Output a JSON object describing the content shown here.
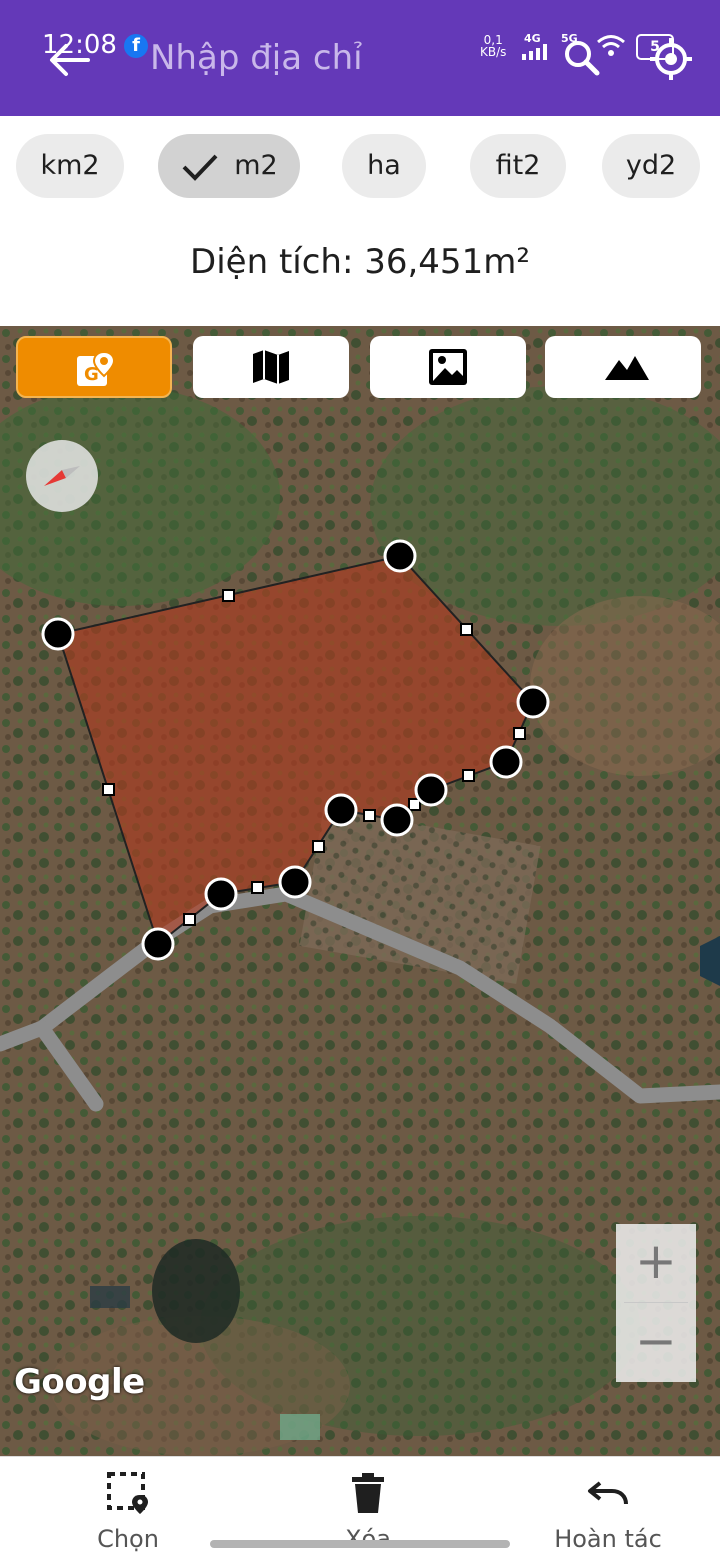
{
  "status_bar": {
    "time": "12:08",
    "facebook_badge": "f",
    "net_speed_value": "0,1",
    "net_speed_unit": "KB/s",
    "network_1": "4G",
    "network_2": "5G",
    "battery": "5"
  },
  "header": {
    "search_placeholder": "Nhập địa chỉ",
    "bg_color": "#6439b8"
  },
  "units": {
    "options": [
      "km2",
      "m2",
      "ha",
      "fit2",
      "yd2"
    ],
    "selected": "m2"
  },
  "area_label": "Diện tích: 36,451m²",
  "map": {
    "types": [
      "google-maps-icon",
      "map-icon",
      "satellite-icon",
      "terrain-icon"
    ],
    "active_type": "google-maps-icon",
    "accent_color": "#ef8c00",
    "polygon_fill": "#a63a22",
    "attribution": "Google",
    "zoom_in_label": "+",
    "zoom_out_label": "−"
  },
  "bottom_bar": {
    "select_label": "Chọn",
    "delete_label": "Xóa",
    "undo_label": "Hoàn tác"
  }
}
